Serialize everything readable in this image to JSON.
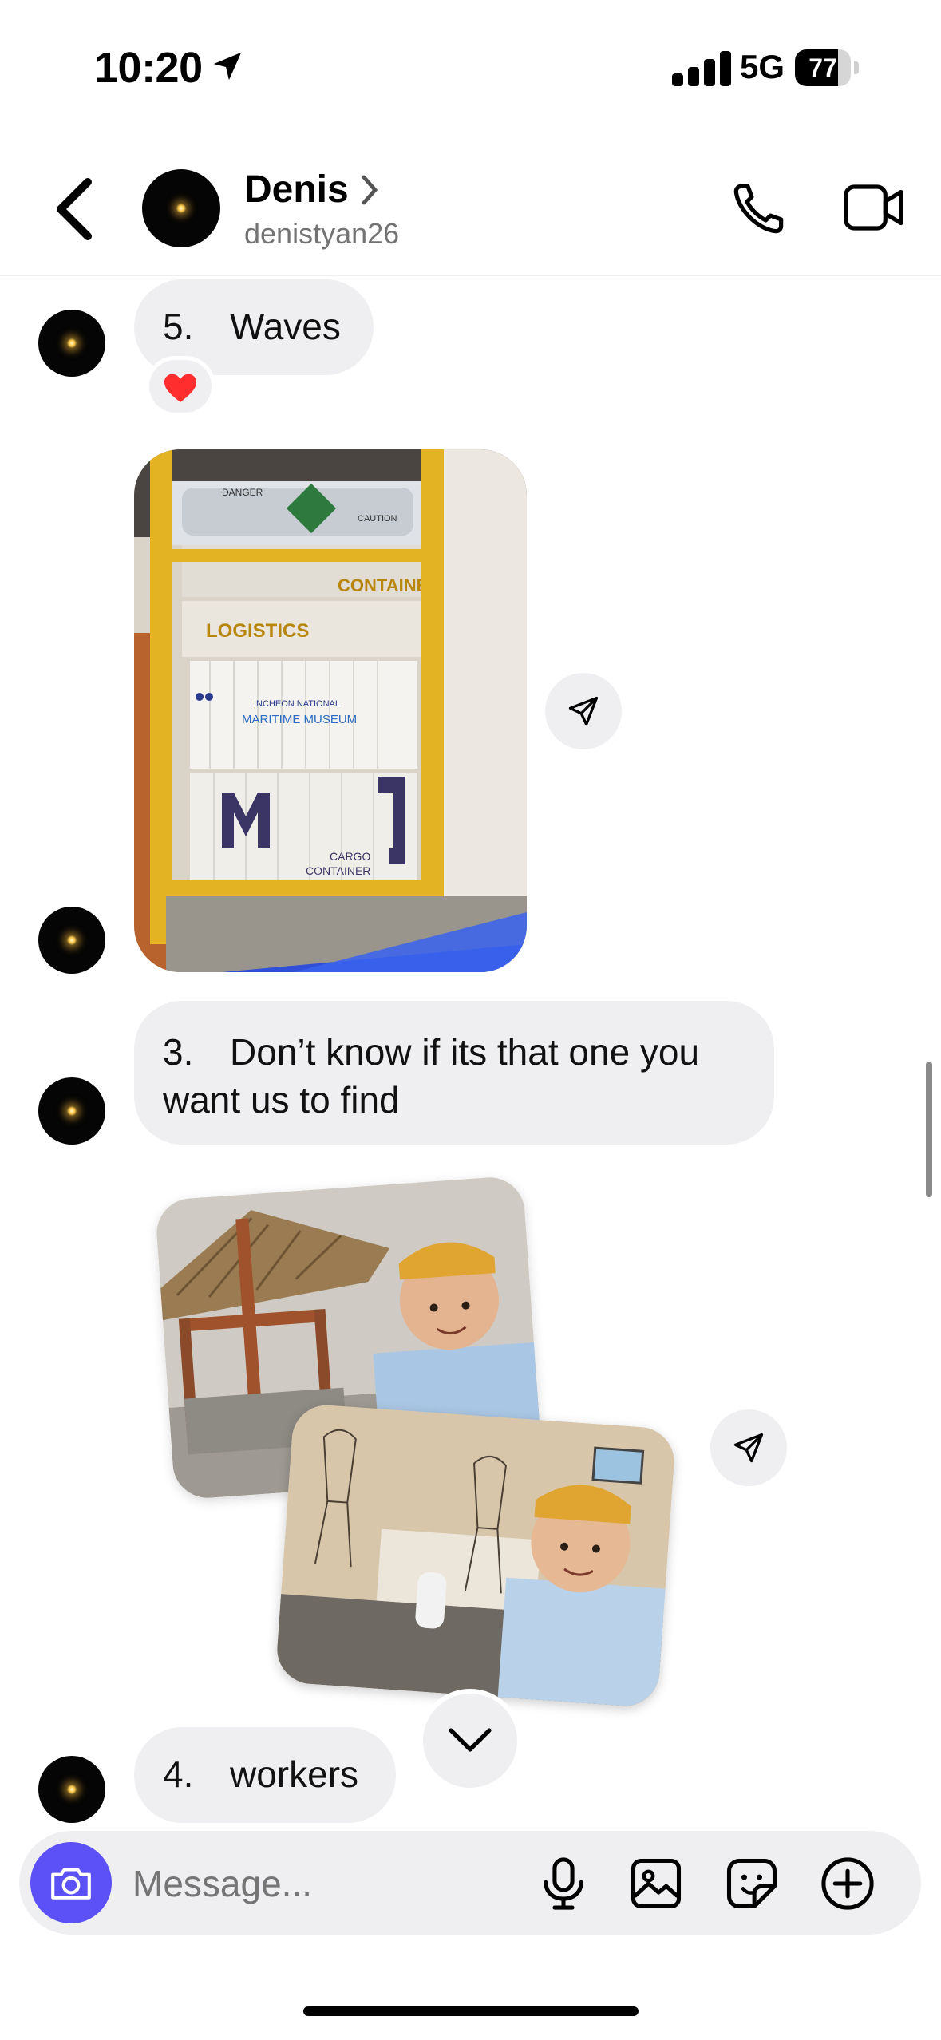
{
  "status_bar": {
    "time": "10:20",
    "network": "5G",
    "battery_percent": "77",
    "battery_level": 0.77
  },
  "header": {
    "name": "Denis",
    "username": "denistyan26"
  },
  "messages": [
    {
      "number": "5.",
      "text": "Waves",
      "reaction": "❤️"
    },
    {
      "number": "3.",
      "text": "Don’t know if its that one you want us to find"
    },
    {
      "number": "4.",
      "text": "workers"
    }
  ],
  "photo1_signs": {
    "container": "CONTAINER",
    "logistics": "LOGISTICS",
    "museum_line1": "INCHEON NATIONAL",
    "museum_line2": "MARITIME MUSEUM",
    "cargo_line1": "CARGO",
    "cargo_line2": "CONTAINER",
    "danger": "DANGER",
    "caution": "CAUTION"
  },
  "composer": {
    "placeholder": "Message..."
  },
  "colors": {
    "accent": "#5b51f7",
    "bubble": "#efeff1",
    "heart": "#ff2d2d"
  },
  "icons": [
    "back-chevron-icon",
    "phone-icon",
    "video-camera-icon",
    "send-arrow-icon",
    "chevron-down-icon",
    "camera-icon",
    "microphone-icon",
    "gallery-icon",
    "sticker-icon",
    "plus-circle-icon"
  ]
}
